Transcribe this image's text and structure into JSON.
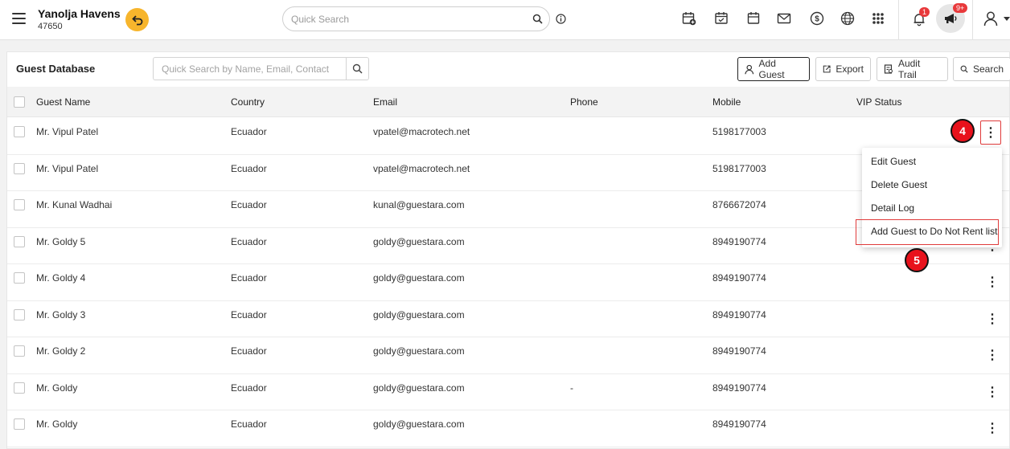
{
  "header": {
    "hotel_name": "Yanolja Havens",
    "hotel_code": "47650",
    "quick_search_placeholder": "Quick Search",
    "notification_badge": "1",
    "announcement_badge": "9+",
    "accent_color": "#f7b52c",
    "icons": [
      "calendar-add-icon",
      "calendar-check-icon",
      "calendar-icon",
      "mail-icon",
      "currency-icon",
      "globe-icon",
      "apps-grid-icon",
      "bell-icon",
      "megaphone-icon",
      "user-icon"
    ]
  },
  "panel": {
    "title": "Guest Database",
    "search_placeholder": "Quick Search by Name, Email, Contact",
    "buttons": {
      "add_guest": "Add Guest",
      "export": "Export",
      "audit_trail": "Audit Trail",
      "search": "Search"
    }
  },
  "table": {
    "columns": [
      "Guest Name",
      "Country",
      "Email",
      "Phone",
      "Mobile",
      "VIP Status"
    ],
    "rows": [
      {
        "name": "Mr. Vipul Patel",
        "country": "Ecuador",
        "email": "vpatel@macrotech.net",
        "phone": "",
        "mobile": "5198177003"
      },
      {
        "name": "Mr. Vipul Patel",
        "country": "Ecuador",
        "email": "vpatel@macrotech.net",
        "phone": "",
        "mobile": "5198177003"
      },
      {
        "name": "Mr. Kunal Wadhai",
        "country": "Ecuador",
        "email": "kunal@guestara.com",
        "phone": "",
        "mobile": "8766672074"
      },
      {
        "name": "Mr. Goldy 5",
        "country": "Ecuador",
        "email": "goldy@guestara.com",
        "phone": "",
        "mobile": "8949190774"
      },
      {
        "name": "Mr. Goldy 4",
        "country": "Ecuador",
        "email": "goldy@guestara.com",
        "phone": "",
        "mobile": "8949190774"
      },
      {
        "name": "Mr. Goldy 3",
        "country": "Ecuador",
        "email": "goldy@guestara.com",
        "phone": "",
        "mobile": "8949190774"
      },
      {
        "name": "Mr. Goldy 2",
        "country": "Ecuador",
        "email": "goldy@guestara.com",
        "phone": "",
        "mobile": "8949190774"
      },
      {
        "name": "Mr. Goldy",
        "country": "Ecuador",
        "email": "goldy@guestara.com",
        "phone": "-",
        "mobile": "8949190774"
      },
      {
        "name": "Mr. Goldy",
        "country": "Ecuador",
        "email": "goldy@guestara.com",
        "phone": "",
        "mobile": "8949190774"
      }
    ]
  },
  "row_menu": {
    "items": [
      "Edit Guest",
      "Delete Guest",
      "Detail Log",
      "Add Guest to Do Not Rent list"
    ]
  },
  "steps": {
    "step_a": "4",
    "step_b": "5"
  }
}
